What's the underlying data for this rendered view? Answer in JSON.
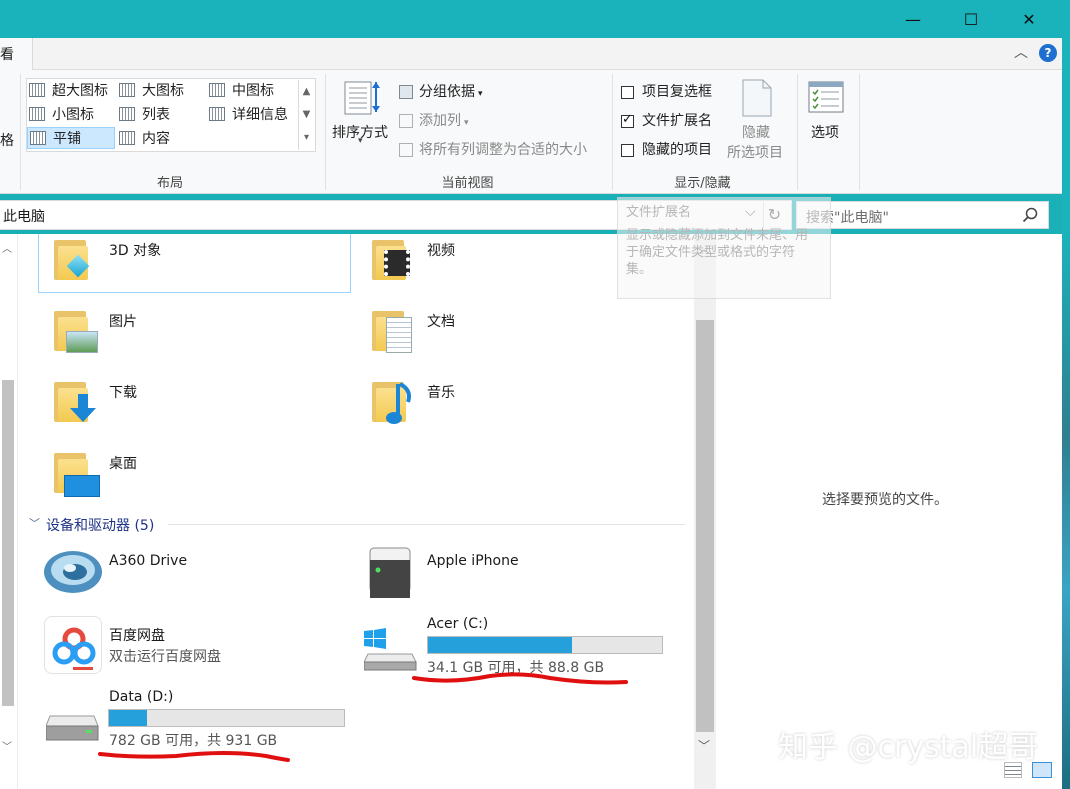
{
  "window": {
    "minimize_icon": "minimize-icon",
    "maximize_icon": "maximize-icon",
    "close_icon": "close-icon",
    "minimize_glyph": "—",
    "maximize_glyph": "☐",
    "close_glyph": "✕"
  },
  "tabs": {
    "view_label": "看",
    "collapse_glyph": "︿",
    "help_glyph": "?"
  },
  "ribbon": {
    "left_cut_label": "格",
    "layout": {
      "group_label": "布局",
      "items": [
        {
          "label": "超大图标"
        },
        {
          "label": "大图标"
        },
        {
          "label": "中图标"
        },
        {
          "label": "小图标"
        },
        {
          "label": "列表"
        },
        {
          "label": "详细信息"
        },
        {
          "label": "平铺"
        },
        {
          "label": "内容"
        }
      ]
    },
    "current_view": {
      "group_label": "当前视图",
      "sort_label": "排序方式",
      "group_by_label": "分组依据",
      "add_column_label": "添加列",
      "fit_columns_label": "将所有列调整为合适的大小"
    },
    "show_hide": {
      "group_label": "显示/隐藏",
      "item_checkboxes_label": "项目复选框",
      "file_extensions_label": "文件扩展名",
      "hidden_items_label": "隐藏的项目",
      "hide_selected_line1": "隐藏",
      "hide_selected_line2": "所选项目",
      "options_label": "选项",
      "checkboxes": {
        "item_checkboxes": false,
        "file_extensions": true,
        "hidden_items": false
      }
    }
  },
  "tooltip": {
    "title": "文件扩展名",
    "body": "显示或隐藏添加到文件末尾、用于确定文件类型或格式的字符集。"
  },
  "address": {
    "path": "此电脑",
    "dropdown_glyph": "⌵",
    "refresh_glyph": "↻"
  },
  "search": {
    "placeholder": "搜索\"此电脑\"",
    "icon": "search-icon"
  },
  "folders": [
    {
      "label": "3D 对象"
    },
    {
      "label": "视频"
    },
    {
      "label": "图片"
    },
    {
      "label": "文档"
    },
    {
      "label": "下载"
    },
    {
      "label": "音乐"
    },
    {
      "label": "桌面"
    }
  ],
  "devices_section": {
    "label": "设备和驱动器 (5)"
  },
  "devices": {
    "a360": {
      "label": "A360 Drive"
    },
    "iphone": {
      "label": "Apple iPhone"
    },
    "baidu": {
      "label": "百度网盘",
      "sub": "双击运行百度网盘"
    },
    "drive_c": {
      "label": "Acer (C:)",
      "free": "34.1 GB 可用，共 88.8 GB",
      "used_fraction": 0.616
    },
    "drive_d": {
      "label": "Data (D:)",
      "free": "782 GB 可用，共 931 GB",
      "used_fraction": 0.16
    }
  },
  "preview": {
    "empty_text": "选择要预览的文件。"
  },
  "watermark": {
    "text": "知乎 @crystal超哥"
  },
  "colors": {
    "titlebar": "#1ab2bb",
    "drive_fill": "#26a0da",
    "annotation_red": "#e01010"
  }
}
